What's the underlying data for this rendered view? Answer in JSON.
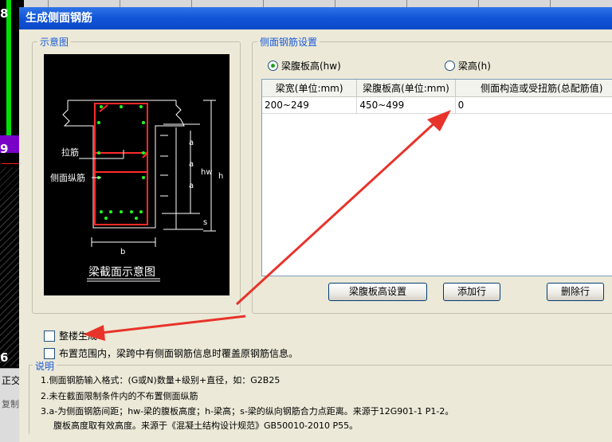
{
  "background": {
    "left_numbers": [
      "8",
      "9",
      "6"
    ],
    "bottom_texts": [
      "正交",
      "复制"
    ]
  },
  "dialog": {
    "title": "生成侧面钢筋",
    "diagram_group_label": "示意图",
    "diagram": {
      "label_lajin": "拉筋",
      "label_cemian": "侧面纵筋",
      "label_a": "a",
      "label_hw": "hw",
      "label_h": "h",
      "label_s": "s",
      "label_b": "b",
      "caption": "梁截面示意图"
    },
    "settings_group_label": "侧面钢筋设置",
    "radios": [
      {
        "label": "梁腹板高(hw)",
        "selected": true
      },
      {
        "label": "梁高(h)",
        "selected": false
      }
    ],
    "table": {
      "headers": [
        "梁宽(单位:mm)",
        "梁腹板高(单位:mm)",
        "侧面构造或受扭筋(总配筋值)"
      ],
      "rows": [
        [
          "200~249",
          "450~499",
          "0"
        ]
      ]
    },
    "buttons": {
      "web_height": "梁腹板高设置",
      "add_row": "添加行",
      "delete_row": "删除行"
    },
    "checkboxes": [
      {
        "label": "整楼生成",
        "checked": false
      },
      {
        "label": "布置范围内，梁跨中有侧面钢筋信息时覆盖原钢筋信息。",
        "checked": false
      }
    ],
    "notes_label": "说明",
    "notes": [
      "1.侧面钢筋输入格式：(G或N)数量+级别+直径，如：G2B25",
      "2.未在截面限制条件内的不布置侧面纵筋",
      "3.a-为侧面钢筋间距；hw-梁的腹板高度；h-梁高；s-梁的纵向钢筋合力点距离。来源于12G901-1 P1-2。",
      "腹板高度取有效高度。来源于《混凝土结构设计规范》GB50010-2010 P55。"
    ]
  },
  "colors": {
    "title_bar": "#1154d6",
    "group_label": "#1a5ad8",
    "dialog_bg": "#ece9d8",
    "annotation_arrow": "#e8332a",
    "rebar_red": "#ff2a2a",
    "rebar_green": "#22ff22"
  }
}
